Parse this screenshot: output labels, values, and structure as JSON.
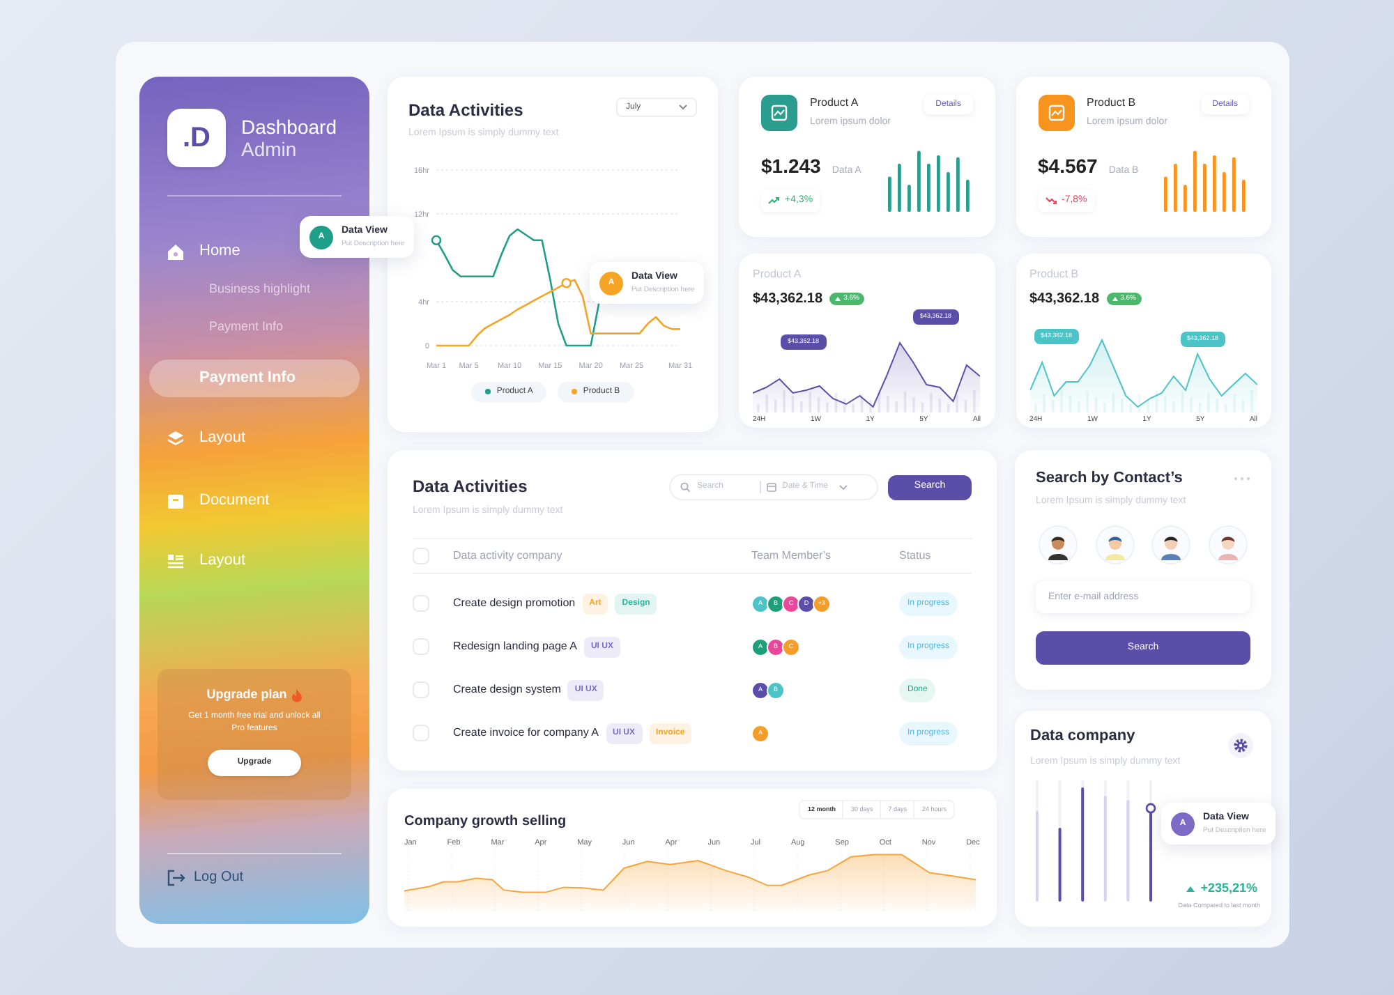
{
  "sidebar": {
    "logo": ".D",
    "title": "Dashboard",
    "subtitle": "Admin",
    "nav": [
      {
        "label": "Home",
        "selected": false,
        "children": [
          {
            "label": "Business highlight",
            "selected": false
          },
          {
            "label": "Payment Info",
            "selected": false
          }
        ]
      },
      {
        "label": "Payment Info",
        "selected": true
      },
      {
        "label": "Layout",
        "selected": false
      },
      {
        "label": "Document",
        "selected": false
      },
      {
        "label": "Layout",
        "selected": false
      }
    ],
    "upgrade": {
      "title": "Upgrade plan",
      "text": "Get 1 month free trial and unlock all Pro features",
      "button": "Upgrade"
    },
    "logout": "Log Out"
  },
  "activity_chart": {
    "title": "Data Activities",
    "subtitle": "Lorem Ipsum is simply dummy text",
    "dropdown": "July",
    "chart_data": {
      "type": "line",
      "categories": [
        "Mar 1",
        null,
        null,
        null,
        "Mar 5",
        null,
        null,
        null,
        null,
        "Mar 10",
        null,
        null,
        null,
        null,
        "Mar 15",
        null,
        null,
        null,
        null,
        "Mar 20",
        null,
        null,
        null,
        null,
        "Mar 25",
        null,
        null,
        null,
        null,
        null,
        "Mar 31"
      ],
      "ylim": [
        0,
        16
      ],
      "yticks": [
        {
          "value": 0,
          "label": "0"
        },
        {
          "value": 4,
          "label": "4hr"
        },
        {
          "value": 12,
          "label": "12hr"
        },
        {
          "value": 16,
          "label": "16hr"
        }
      ],
      "series": [
        {
          "name": "Product A",
          "color": "#1f9e8a",
          "values": [
            9.6,
            8.3,
            6.9,
            6.3,
            6.3,
            6.3,
            6.3,
            6.3,
            8.3,
            10,
            10.6,
            10.1,
            9.6,
            9.6,
            6,
            2,
            0,
            0,
            0,
            0,
            3.9,
            null,
            null,
            null,
            null,
            null,
            null,
            null,
            null,
            null,
            null
          ]
        },
        {
          "name": "Product B",
          "color": "#f5a524",
          "values": [
            0,
            0,
            0,
            0,
            0,
            0.9,
            1.6,
            2,
            2.4,
            2.8,
            3.3,
            3.7,
            4.1,
            4.5,
            4.9,
            5.3,
            5.7,
            6,
            4.5,
            1.1,
            1.1,
            1.1,
            1.1,
            1.1,
            1.1,
            1.1,
            2,
            2.6,
            1.8,
            1.5,
            1.5
          ]
        }
      ]
    },
    "tooltips": [
      {
        "avatar": "A",
        "title": "Data View",
        "description": "Put Description here",
        "color": "#1f9e8a"
      },
      {
        "avatar": "A",
        "title": "Data View",
        "description": "Put Description here",
        "color": "#f5a524"
      }
    ]
  },
  "product_cards": [
    {
      "title": "Product A",
      "subtitle": "Lorem ipsum dolor",
      "button": "Details",
      "value": "$1.243",
      "value_label": "Data A",
      "change": "+4,3%",
      "kind": "up",
      "color": "#2a9d8f"
    },
    {
      "title": "Product B",
      "subtitle": "Lorem ipsum dolor",
      "button": "Details",
      "value": "$4.567",
      "value_label": "Data B",
      "change": "-7,8%",
      "kind": "down",
      "color": "#f7941d"
    }
  ],
  "area_cards": [
    {
      "title": "Product A",
      "value": "$43,362.18",
      "badge": "3.6%",
      "callouts": [
        "$43,362.18",
        "$43,362.18"
      ],
      "x_labels": [
        "24H",
        "1W",
        "1Y",
        "5Y",
        "All"
      ],
      "color": "#5b4ea8"
    },
    {
      "title": "Product B",
      "value": "$43,362.18",
      "badge": "3.6%",
      "callouts": [
        "$43,362.18",
        "$43,362.18"
      ],
      "x_labels": [
        "24H",
        "1W",
        "1Y",
        "5Y",
        "All"
      ],
      "color": "#4cc3c7"
    }
  ],
  "activities": {
    "title": "Data Activities",
    "subtitle": "Lorem Ipsum is simply dummy text",
    "search": {
      "placeholder": "Search"
    },
    "date_filter": "Date & Time",
    "button": "Search",
    "header_checked": false,
    "columns": [
      "Data activity company",
      "Team Member’s",
      "Status"
    ],
    "rows": [
      {
        "checked": false,
        "task": "Create design promotion",
        "tags": [
          {
            "label": "Art",
            "color": "#f5a524"
          },
          {
            "label": "Design",
            "color": "#2bb59a"
          }
        ],
        "members": [
          {
            "initial": "A",
            "color": "#4cc3c7"
          },
          {
            "initial": "B",
            "color": "#1f9e7a"
          },
          {
            "initial": "C",
            "color": "#e9489a"
          },
          {
            "initial": "D",
            "color": "#5b4ea8"
          },
          {
            "initial": "+3",
            "color": "#f59d2a"
          }
        ],
        "status": {
          "label": "In progress",
          "kind": "progress"
        }
      },
      {
        "checked": false,
        "task": "Redesign landing page A",
        "tags": [
          {
            "label": "UI UX",
            "color": "#7b6bc4"
          }
        ],
        "members": [
          {
            "initial": "A",
            "color": "#1f9e7a"
          },
          {
            "initial": "B",
            "color": "#e9489a"
          },
          {
            "initial": "C",
            "color": "#f59d2a"
          }
        ],
        "status": {
          "label": "In progress",
          "kind": "progress"
        }
      },
      {
        "checked": false,
        "task": "Create design system",
        "tags": [
          {
            "label": "UI UX",
            "color": "#7b6bc4"
          }
        ],
        "members": [
          {
            "initial": "A",
            "color": "#5b4ea8"
          },
          {
            "initial": "B",
            "color": "#4cc3c7"
          }
        ],
        "status": {
          "label": "Done",
          "kind": "done"
        }
      },
      {
        "checked": false,
        "task": "Create invoice for company A",
        "tags": [
          {
            "label": "UI UX",
            "color": "#7b6bc4"
          },
          {
            "label": "Invoice",
            "color": "#f5a524"
          }
        ],
        "members": [
          {
            "initial": "A",
            "color": "#f59d2a"
          }
        ],
        "status": {
          "label": "In progress",
          "kind": "progress"
        }
      }
    ]
  },
  "contacts": {
    "title": "Search by Contact’s",
    "subtitle": "Lorem Ipsum is simply dummy text",
    "email": {
      "placeholder": "Enter e-mail address"
    },
    "button": "Search"
  },
  "growth": {
    "title": "Company growth selling",
    "ranges": [
      {
        "label": "12 month",
        "selected": true
      },
      {
        "label": "30 days",
        "selected": false
      },
      {
        "label": "7 days",
        "selected": false
      },
      {
        "label": "24 hours",
        "selected": false
      }
    ],
    "months": [
      "Jan",
      "Feb",
      "Mar",
      "Apr",
      "May",
      "Jun",
      "Apr",
      "Jun",
      "Jul",
      "Aug",
      "Sep",
      "Oct",
      "Nov",
      "Dec"
    ]
  },
  "data_company": {
    "title": "Data company",
    "subtitle": "Lorem Ipsum is simply dummy text",
    "tooltip": {
      "avatar": "A",
      "title": "Data View",
      "description": "Put Description here",
      "color": "#7b6bc4"
    },
    "change": "+235,21%",
    "note": "Data Compared to last month"
  }
}
